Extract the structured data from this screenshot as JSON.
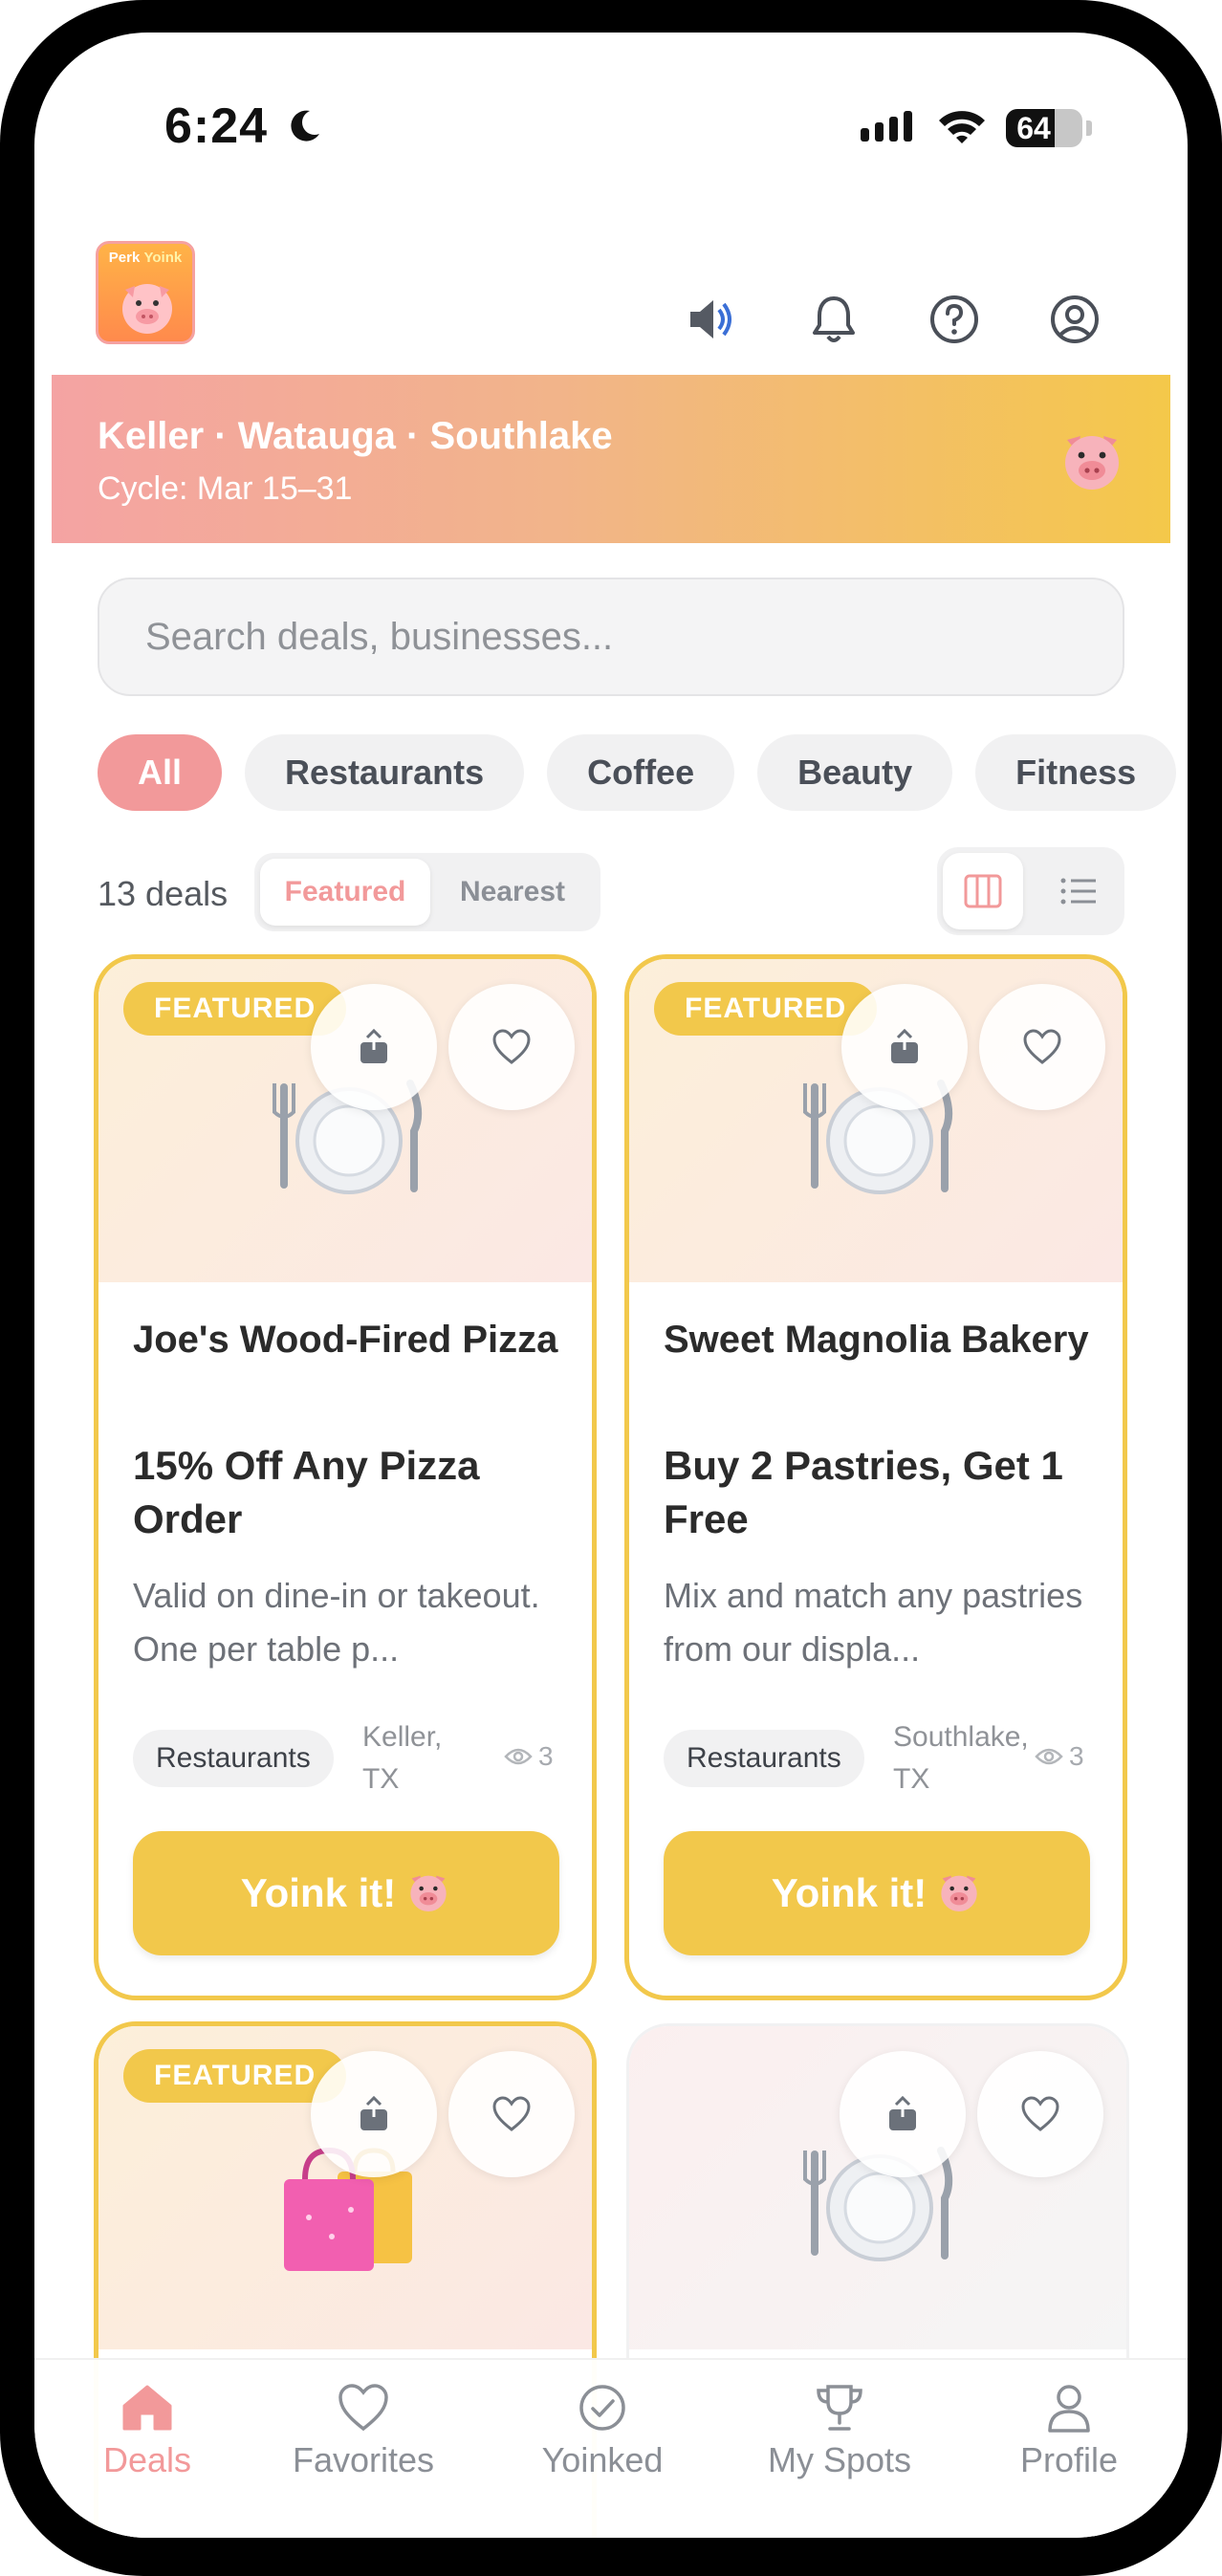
{
  "status_bar": {
    "time": "6:24",
    "battery": "64",
    "battery_level": 0.64
  },
  "header": {
    "logo_text_1": "Perk",
    "logo_text_2": "Yoink",
    "icons": [
      "speaker-icon",
      "bell-icon",
      "help-icon",
      "account-icon"
    ]
  },
  "banner": {
    "title": "Keller · Watauga · Southlake",
    "subtitle": "Cycle: Mar 15–31"
  },
  "search": {
    "placeholder": "Search deals, businesses..."
  },
  "chips": [
    {
      "label": "All",
      "active": true
    },
    {
      "label": "Restaurants",
      "active": false
    },
    {
      "label": "Coffee",
      "active": false
    },
    {
      "label": "Beauty",
      "active": false
    },
    {
      "label": "Fitness",
      "active": false
    }
  ],
  "toolbar": {
    "count": "13 deals",
    "sort_featured": "Featured",
    "sort_nearest": "Nearest"
  },
  "cards": [
    {
      "badge": "FEATURED",
      "business": "Joe's Wood-Fired Pizza",
      "offer": "15% Off Any Pizza Order",
      "description": "Valid on dine-in or takeout. One per table p...",
      "category": "Restaurants",
      "location": "Keller, TX",
      "views": "3",
      "button": "Yoink it!"
    },
    {
      "badge": "FEATURED",
      "business": "Sweet Magnolia Bakery",
      "offer": "Buy 2 Pastries, Get 1 Free",
      "description": "Mix and match any pastries from our displa...",
      "category": "Restaurants",
      "location": "Southlake, TX",
      "views": "3",
      "button": "Yoink it!"
    },
    {
      "badge": "FEATURED"
    },
    {}
  ],
  "tabs": [
    {
      "label": "Deals",
      "icon": "home-icon",
      "active": true
    },
    {
      "label": "Favorites",
      "icon": "heart-icon",
      "active": false
    },
    {
      "label": "Yoinked",
      "icon": "check-circle-icon",
      "active": false
    },
    {
      "label": "My Spots",
      "icon": "trophy-icon",
      "active": false
    },
    {
      "label": "Profile",
      "icon": "person-icon",
      "active": false
    }
  ],
  "colors": {
    "accent": "#f2999a",
    "gold": "#f2c84b",
    "banner_start": "#f4a3a3",
    "banner_end": "#f4c84a"
  }
}
